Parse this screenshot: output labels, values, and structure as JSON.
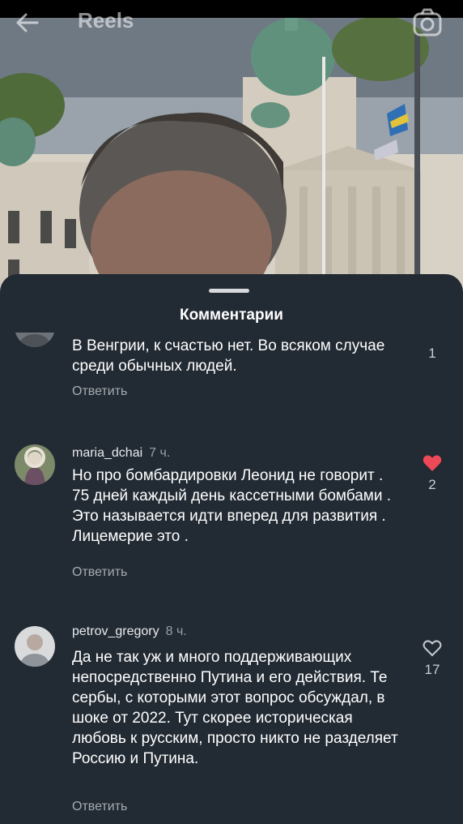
{
  "header": {
    "title": "Reels"
  },
  "sheet": {
    "title": "Комментарии"
  },
  "comments": [
    {
      "username": "",
      "time": "",
      "text": "В Венгрии, к счастью нет. Во всяком случае среди обычных людей.",
      "reply_label": "Ответить",
      "likes": "1",
      "liked": false
    },
    {
      "username": "maria_dchai",
      "time": "7 ч.",
      "text": "Но про бомбардировки  Леонид не говорит . 75 дней каждый день кассетными бомбами . Это называется идти вперед  для развития . Лицемерие это .",
      "reply_label": "Ответить",
      "likes": "2",
      "liked": true
    },
    {
      "username": "petrov_gregory",
      "time": "8 ч.",
      "text": "Да не так уж и много поддерживающих непосредственно Путина и его действия. Те сербы, с которыми этот вопрос обсуждал, в шоке от 2022. Тут скорее историческая любовь к русским, просто никто не разделяет Россию и Путина.",
      "reply_label": "Ответить",
      "likes": "17",
      "liked": false
    }
  ],
  "colors": {
    "sheet_bg": "#222a33",
    "like_active": "#ed4956"
  },
  "icons": {
    "back": "arrow-left-icon",
    "camera": "camera-icon",
    "like": "heart-icon"
  }
}
